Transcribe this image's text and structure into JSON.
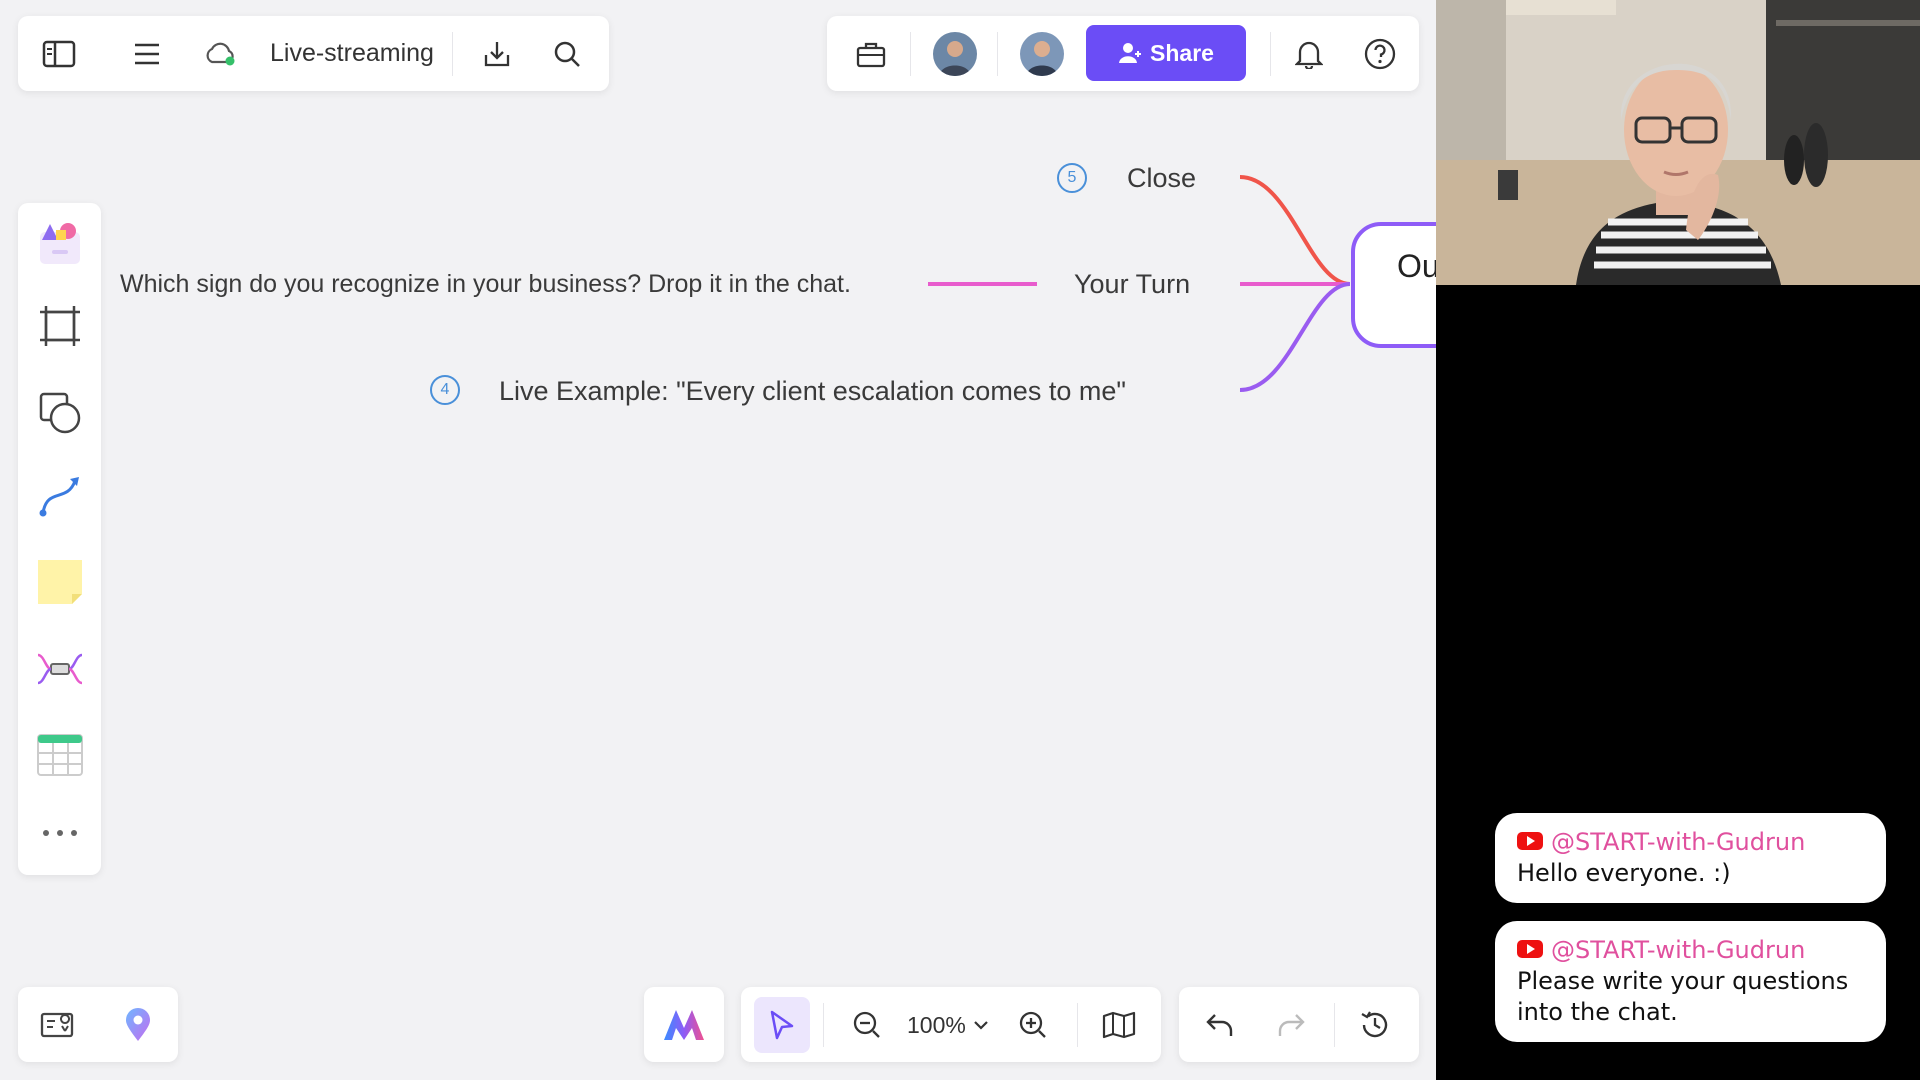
{
  "header": {
    "board_title": "Live-streaming",
    "share_label": "Share"
  },
  "mindmap": {
    "root_text": "Ou",
    "branches": [
      {
        "number": "5",
        "label": "Close",
        "color": "#f0554a"
      },
      {
        "number": "",
        "label": "Your Turn",
        "color": "#e85ccd",
        "child": "Which sign do you recognize in your business? Drop it in the chat."
      },
      {
        "number": "4",
        "label": "Live Example: \"Every client escalation comes to me\"",
        "color": "#9a5cf0"
      }
    ]
  },
  "zoom": {
    "value": "100%"
  },
  "chat": {
    "messages": [
      {
        "user": "@START-with-Gudrun",
        "text": " Hello everyone. :)"
      },
      {
        "user": "@START-with-Gudrun",
        "text": " Please write your questions into the chat."
      }
    ]
  },
  "colors": {
    "accent": "#6b4df6",
    "board_bg": "#f2f2f4",
    "chat_user": "#e0509e"
  }
}
